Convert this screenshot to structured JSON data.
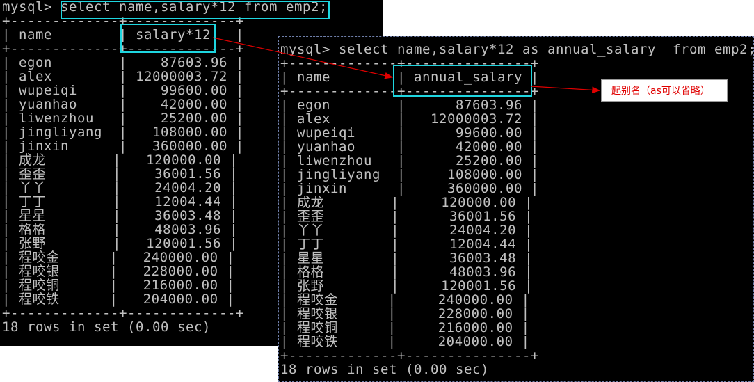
{
  "left_terminal": {
    "command_prompt": "mysql> ",
    "command": "select name,salary*12 from emp2;",
    "border_line": "+-------------+-------------+",
    "header_line": "| name        | salary*12   |",
    "rows": [
      {
        "name": "egon",
        "value": "87603.96"
      },
      {
        "name": "alex",
        "value": "12000003.72"
      },
      {
        "name": "wupeiqi",
        "value": "99600.00"
      },
      {
        "name": "yuanhao",
        "value": "42000.00"
      },
      {
        "name": "liwenzhou",
        "value": "25200.00"
      },
      {
        "name": "jingliyang",
        "value": "108000.00"
      },
      {
        "name": "jinxin",
        "value": "360000.00"
      },
      {
        "name": "成龙",
        "value": "120000.00"
      },
      {
        "name": "歪歪",
        "value": "36001.56"
      },
      {
        "name": "丫丫",
        "value": "24004.20"
      },
      {
        "name": "丁丁",
        "value": "12004.44"
      },
      {
        "name": "星星",
        "value": "36003.48"
      },
      {
        "name": "格格",
        "value": "48003.96"
      },
      {
        "name": "张野",
        "value": "120001.56"
      },
      {
        "name": "程咬金",
        "value": "240000.00"
      },
      {
        "name": "程咬银",
        "value": "228000.00"
      },
      {
        "name": "程咬铜",
        "value": "216000.00"
      },
      {
        "name": "程咬铁",
        "value": "204000.00"
      }
    ],
    "footer": "18 rows in set (0.00 sec)"
  },
  "right_terminal": {
    "command_line": "mysql> select name,salary*12 as annual_salary  from emp2;",
    "border_line": "+-------------+---------------+",
    "header_line": "| name        | annual_salary |",
    "rows": [
      {
        "name": "egon",
        "value": "87603.96"
      },
      {
        "name": "alex",
        "value": "12000003.72"
      },
      {
        "name": "wupeiqi",
        "value": "99600.00"
      },
      {
        "name": "yuanhao",
        "value": "42000.00"
      },
      {
        "name": "liwenzhou",
        "value": "25200.00"
      },
      {
        "name": "jingliyang",
        "value": "108000.00"
      },
      {
        "name": "jinxin",
        "value": "360000.00"
      },
      {
        "name": "成龙",
        "value": "120000.00"
      },
      {
        "name": "歪歪",
        "value": "36001.56"
      },
      {
        "name": "丫丫",
        "value": "24004.20"
      },
      {
        "name": "丁丁",
        "value": "12004.44"
      },
      {
        "name": "星星",
        "value": "36003.48"
      },
      {
        "name": "格格",
        "value": "48003.96"
      },
      {
        "name": "张野",
        "value": "120001.56"
      },
      {
        "name": "程咬金",
        "value": "240000.00"
      },
      {
        "name": "程咬银",
        "value": "228000.00"
      },
      {
        "name": "程咬铜",
        "value": "216000.00"
      },
      {
        "name": "程咬铁",
        "value": "204000.00"
      }
    ],
    "footer": "18 rows in set (0.00 sec)"
  },
  "annotation": {
    "text": "起别名（as可以省略）",
    "arrow_color": "#e00000",
    "highlight_color": "#1ed6e0"
  }
}
